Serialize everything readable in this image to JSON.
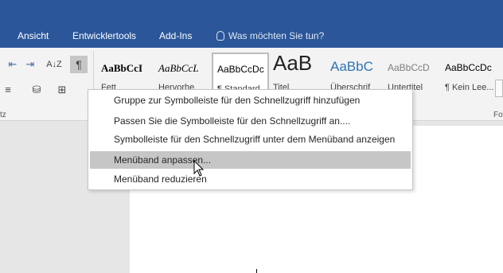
{
  "ribbon_tabs": [
    "Ansicht",
    "Entwicklertools",
    "Add-Ins"
  ],
  "tell_me": "Was möchten Sie tun?",
  "toolbar": {
    "pilcrow": "¶",
    "sort": "A↓Z",
    "indent_left": "⇤",
    "indent_right": "⇥"
  },
  "group_labels": {
    "left": "tz",
    "right": "Fo"
  },
  "styles": [
    {
      "preview": "AaBbCcI",
      "name": "Fett"
    },
    {
      "preview": "AaBbCcL",
      "name": "Hervorhe"
    },
    {
      "preview": "AaBbCcDc",
      "name": "¶ Standard"
    },
    {
      "preview": "AaB",
      "name": "Titel"
    },
    {
      "preview": "AaBbC",
      "name": "Überschrif"
    },
    {
      "preview": "AaBbCcD",
      "name": "Untertitel"
    },
    {
      "preview": "AaBbCcDc",
      "name": "¶ Kein Lee..."
    }
  ],
  "menu": {
    "items": [
      "Gruppe zur Symbolleiste für den Schnellzugriff hinzufügen",
      "Passen Sie die Symbolleiste für den Schnellzugriff an....",
      "Symbolleiste für den Schnellzugriff unter dem Menüband anzeigen",
      "Menüband anpassen...",
      "Menüband reduzieren"
    ],
    "highlighted_index": 3
  },
  "colors": {
    "ribbon_tab_bar": "#2b579a",
    "menu_highlight": "#c6c6c6",
    "title_style": "#2e74b5"
  }
}
